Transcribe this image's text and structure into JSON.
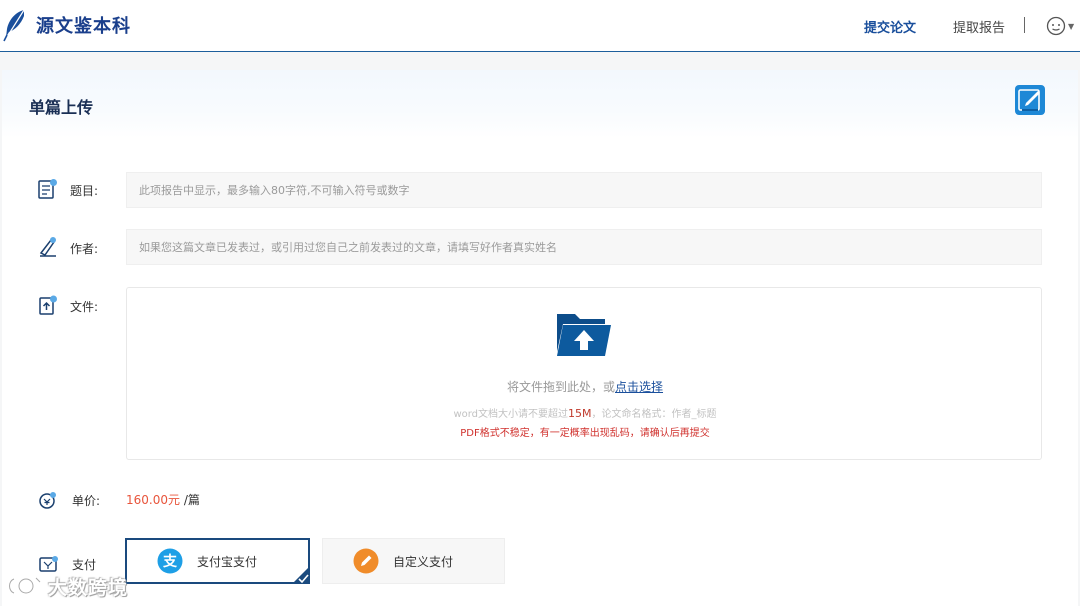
{
  "header": {
    "brand": "源文鉴本科",
    "nav": {
      "submit": "提交论文",
      "report": "提取报告"
    }
  },
  "panel": {
    "title": "单篇上传"
  },
  "form": {
    "title": {
      "label": "题目:",
      "placeholder": "此项报告中显示，最多输入80字符,不可输入符号或数字"
    },
    "author": {
      "label": "作者:",
      "placeholder": "如果您这篇文章已发表过，或引用过您自己之前发表过的文章，请填写好作者真实姓名"
    },
    "file": {
      "label": "文件:",
      "hint_prefix": "将文件拖到此处，或",
      "hint_link": "点击选择",
      "size_prefix": "word文档大小请不要超过",
      "size_value": "15M",
      "size_suffix": "，论文命名格式：作者_标题",
      "warning": "PDF格式不稳定，有一定概率出现乱码，请确认后再提交"
    },
    "price": {
      "label": "单价:",
      "amount": "160.00元",
      "unit": "/篇"
    },
    "payment": {
      "label": "支付",
      "options": [
        {
          "label": "支付宝支付",
          "icon": "alipay-icon",
          "selected": true
        },
        {
          "label": "自定义支付",
          "icon": "pencil-icon",
          "selected": false
        }
      ]
    }
  },
  "watermark": {
    "text": "大数跨境"
  },
  "colors": {
    "primary": "#1a4f9c",
    "price": "#e8553c",
    "warning": "#d0312d",
    "alipay": "#1e9fe6",
    "custom": "#f08c2a"
  }
}
